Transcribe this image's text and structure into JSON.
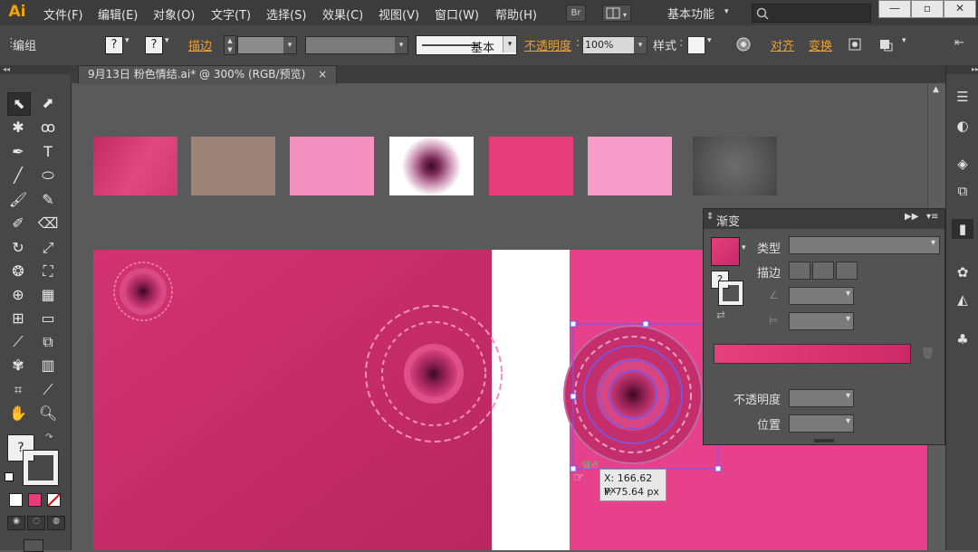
{
  "app": {
    "logo": "Ai"
  },
  "menu": [
    "文件(F)",
    "编辑(E)",
    "对象(O)",
    "文字(T)",
    "选择(S)",
    "效果(C)",
    "视图(V)",
    "窗口(W)",
    "帮助(H)"
  ],
  "menubar": {
    "bridge_label": "Br",
    "workspace": "基本功能",
    "search_placeholder": ""
  },
  "control": {
    "mode_label": "编组",
    "fill_value": "?",
    "stroke_value": "?",
    "stroke_label": "描边",
    "stroke_style": "基本",
    "opacity_label": "不透明度",
    "opacity_value": "100%",
    "style_label": "样式",
    "align_label": "对齐",
    "transform_label": "变换"
  },
  "document": {
    "tab_title": "9月13日 粉色情结.ai* @ 300% (RGB/预览)",
    "close": "×"
  },
  "swatches": [
    {
      "name": "pink-gradient-swatch",
      "color": "#d63a78"
    },
    {
      "name": "taupe-swatch",
      "color": "#9c8479"
    },
    {
      "name": "light-pink-swatch",
      "color": "#f490c0"
    },
    {
      "name": "radial-dark-swatch",
      "color": "#5a1a3a"
    },
    {
      "name": "hot-pink-swatch",
      "color": "#e63c78"
    },
    {
      "name": "pale-pink-swatch",
      "color": "#f59cc8"
    },
    {
      "name": "gray-radial-swatch",
      "color": "#6a6a6a"
    }
  ],
  "colors": {
    "artboard_left": "#c92d69",
    "artboard_right": "#e63f84",
    "accent_orange": "#f0a030",
    "selection": "#6a5cff"
  },
  "gradient_panel": {
    "title": "渐变",
    "type_label": "类型",
    "stroke_label": "描边",
    "opacity_label": "不透明度",
    "position_label": "位置",
    "gradient_start": "#e6407a",
    "gradient_end": "#cc2a66"
  },
  "selection": {
    "anchor_label": "锚点",
    "x_readout": "X: 166.62 px",
    "y_readout": "Y: 75.64 px"
  }
}
